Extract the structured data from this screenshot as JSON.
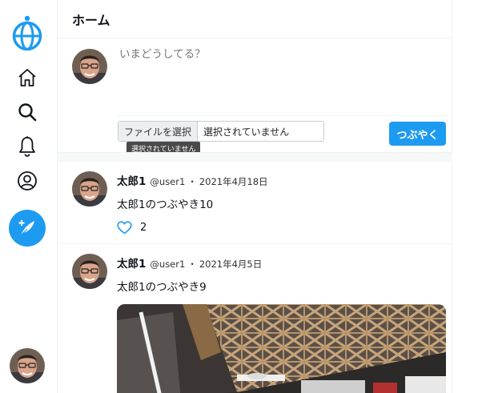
{
  "colors": {
    "accent": "#1d9bf0",
    "border": "#eff3f4",
    "tooltip_bg": "#4a4a4a"
  },
  "icons": {
    "logo": "globe-icon",
    "home": "home-icon",
    "search": "search-icon",
    "notifications": "bell-icon",
    "profile": "user-circle-icon",
    "compose": "feather-plus-icon",
    "like": "heart-icon"
  },
  "header": {
    "title": "ホーム"
  },
  "composer": {
    "placeholder": "いまどうしてる？",
    "file_button": "ファイルを選択",
    "file_status": "選択されていません",
    "tooltip": "選択されていません",
    "submit_label": "つぶやく"
  },
  "tweets": [
    {
      "name": "太郎1",
      "handle": "@user1",
      "separator": "・",
      "date": "2021年4月18日",
      "text": "太郎1のつぶやき10",
      "likes": "2"
    },
    {
      "name": "太郎1",
      "handle": "@user1",
      "separator": "・",
      "date": "2021年4月5日",
      "text": "太郎1のつぶやき9"
    }
  ]
}
